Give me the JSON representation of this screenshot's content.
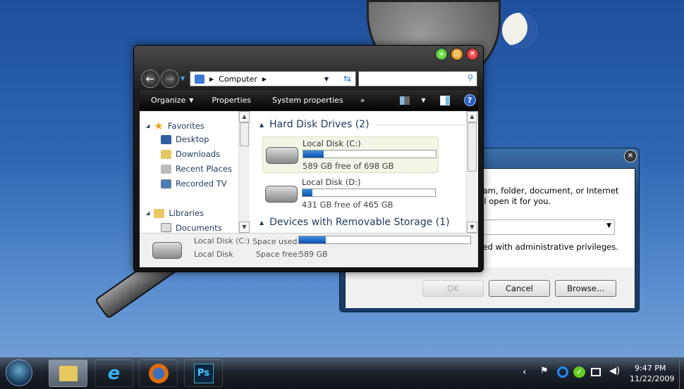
{
  "explorer": {
    "address": "Computer",
    "toolbar": {
      "organize": "Organize",
      "properties": "Properties",
      "system_properties": "System properties",
      "more": "»"
    },
    "nav": {
      "favorites": "Favorites",
      "items": [
        "Desktop",
        "Downloads",
        "Recent Places",
        "Recorded TV"
      ],
      "libraries": "Libraries",
      "documents": "Documents"
    },
    "groups": {
      "hdd": "Hard Disk Drives (2)",
      "removable": "Devices with Removable Storage (1)"
    },
    "disks": [
      {
        "name": "Local Disk (C:)",
        "free": "589 GB free of 698 GB",
        "used_fraction": 0.156
      },
      {
        "name": "Local Disk (D:)",
        "free": "431 GB free of 465 GB",
        "used_fraction": 0.073
      }
    ],
    "details": {
      "name": "Local Disk (C:)",
      "type": "Local Disk",
      "space_used_label": "Space used:",
      "space_free_label": "Space free:",
      "space_free": "589 GB",
      "used_fraction": 0.156
    }
  },
  "run": {
    "line1": "ram, folder, document, or Internet",
    "line2": "ill open it for you.",
    "admin": "ted with administrative privileges.",
    "ok": "OK",
    "cancel": "Cancel",
    "browse": "Browse..."
  },
  "taskbar": {
    "time": "9:47 PM",
    "date": "11/22/2009",
    "ps": "Ps"
  }
}
